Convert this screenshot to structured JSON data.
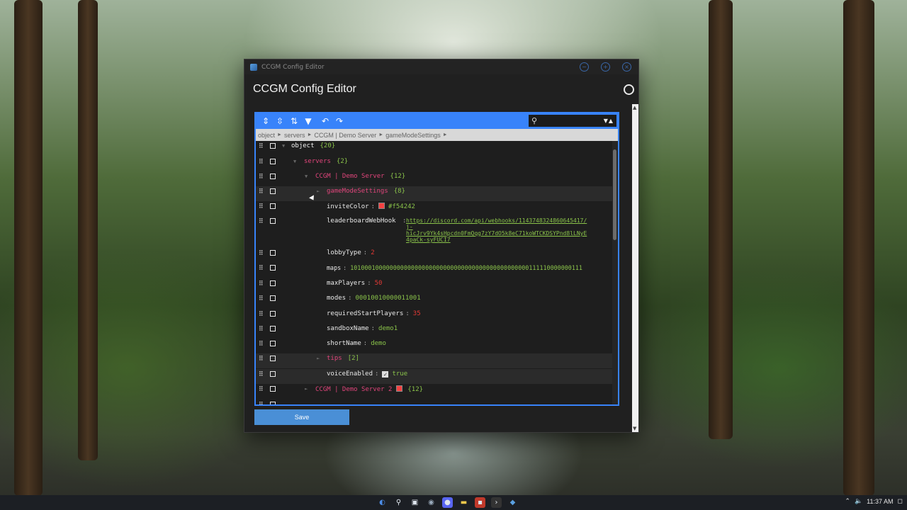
{
  "window": {
    "titlebar_title": "CCGM Config Editor",
    "header_title": "CCGM Config Editor"
  },
  "editor": {
    "breadcrumb": [
      "object",
      "servers",
      "CCGM | Demo Server",
      "gameModeSettings"
    ],
    "search": {
      "value": "",
      "placeholder": ""
    },
    "rows": {
      "root": {
        "field": "object",
        "count": "{20}"
      },
      "servers": {
        "field": "servers",
        "count": "{2}"
      },
      "server1": {
        "field": "CCGM | Demo Server",
        "count": "{12}"
      },
      "gameModeSettings": {
        "field": "gameModeSettings",
        "count": "{8}"
      },
      "inviteColor": {
        "field": "inviteColor",
        "value": "#f54242"
      },
      "leaderboardWebHook": {
        "field": "leaderboardWebHook",
        "line1": "https://discord.com/api/webhooks/1143748324860645417/",
        "line2": "j-",
        "line3": "hicJrv9Yk4sHpcdn0FmQqg7zY7dO5k8eC71koWTCKDSYPnd8lLNyE",
        "line4": "4paCk-syFUCI7"
      },
      "lobbyType": {
        "field": "lobbyType",
        "value": "2"
      },
      "maps": {
        "field": "maps",
        "value": "10100010000000000000000000000000000000000000000000111110000000111"
      },
      "maxPlayers": {
        "field": "maxPlayers",
        "value": "50"
      },
      "modes": {
        "field": "modes",
        "value": "00010010000011001"
      },
      "requiredStartPlayers": {
        "field": "requiredStartPlayers",
        "value": "35"
      },
      "sandboxName": {
        "field": "sandboxName",
        "value": "demo1"
      },
      "shortName": {
        "field": "shortName",
        "value": "demo"
      },
      "tips": {
        "field": "tips",
        "count": "[2]"
      },
      "voiceEnabled": {
        "field": "voiceEnabled",
        "value": "true"
      },
      "server2": {
        "field": "CCGM | Demo Server 2",
        "count": "{12}"
      }
    }
  },
  "save_label": "Save",
  "taskbar": {
    "time": "11:37 AM"
  },
  "colors": {
    "accent": "#3883fa",
    "field_object": "#e0457b",
    "value_string": "#8ac34a",
    "value_number": "#e53935",
    "invite_color": "#f54242"
  }
}
